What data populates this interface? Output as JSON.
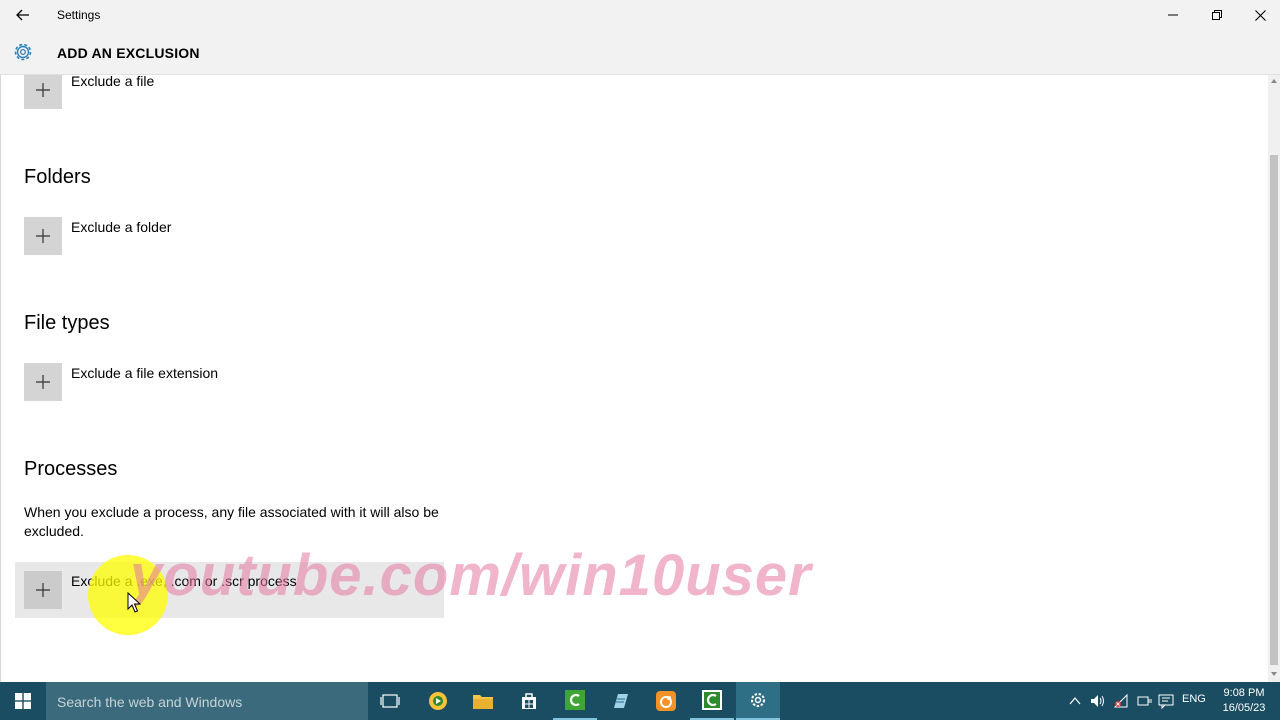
{
  "window": {
    "title": "Settings",
    "back_icon": "arrow-left-icon",
    "minimize_icon": "minimize-icon",
    "maximize_icon": "restore-icon",
    "close_icon": "close-icon"
  },
  "header": {
    "icon": "gear-icon",
    "title": "ADD AN EXCLUSION",
    "accent": "#2d7fb8"
  },
  "sections": {
    "files": {
      "button_label": "Exclude a file"
    },
    "folders": {
      "heading": "Folders",
      "button_label": "Exclude a folder"
    },
    "file_types": {
      "heading": "File types",
      "button_label": "Exclude a file extension"
    },
    "processes": {
      "heading": "Processes",
      "description": "When you exclude a process, any file associated with it will also be excluded.",
      "button_label": "Exclude a .exe, .com or .scr process"
    }
  },
  "watermark": "youtube.com/win10user",
  "taskbar": {
    "search_placeholder": "Search the web and Windows",
    "language": "ENG",
    "time": "9:08 PM",
    "date": "16/05/23",
    "colors": {
      "background": "#1a4d61",
      "search": "#3a6a7b"
    },
    "apps": [
      "task-view-icon",
      "media-player-icon",
      "file-explorer-icon",
      "store-icon",
      "camtasia-icon",
      "notepad-icon",
      "uc-browser-icon",
      "camtasia-recorder-icon",
      "settings-icon"
    ]
  }
}
